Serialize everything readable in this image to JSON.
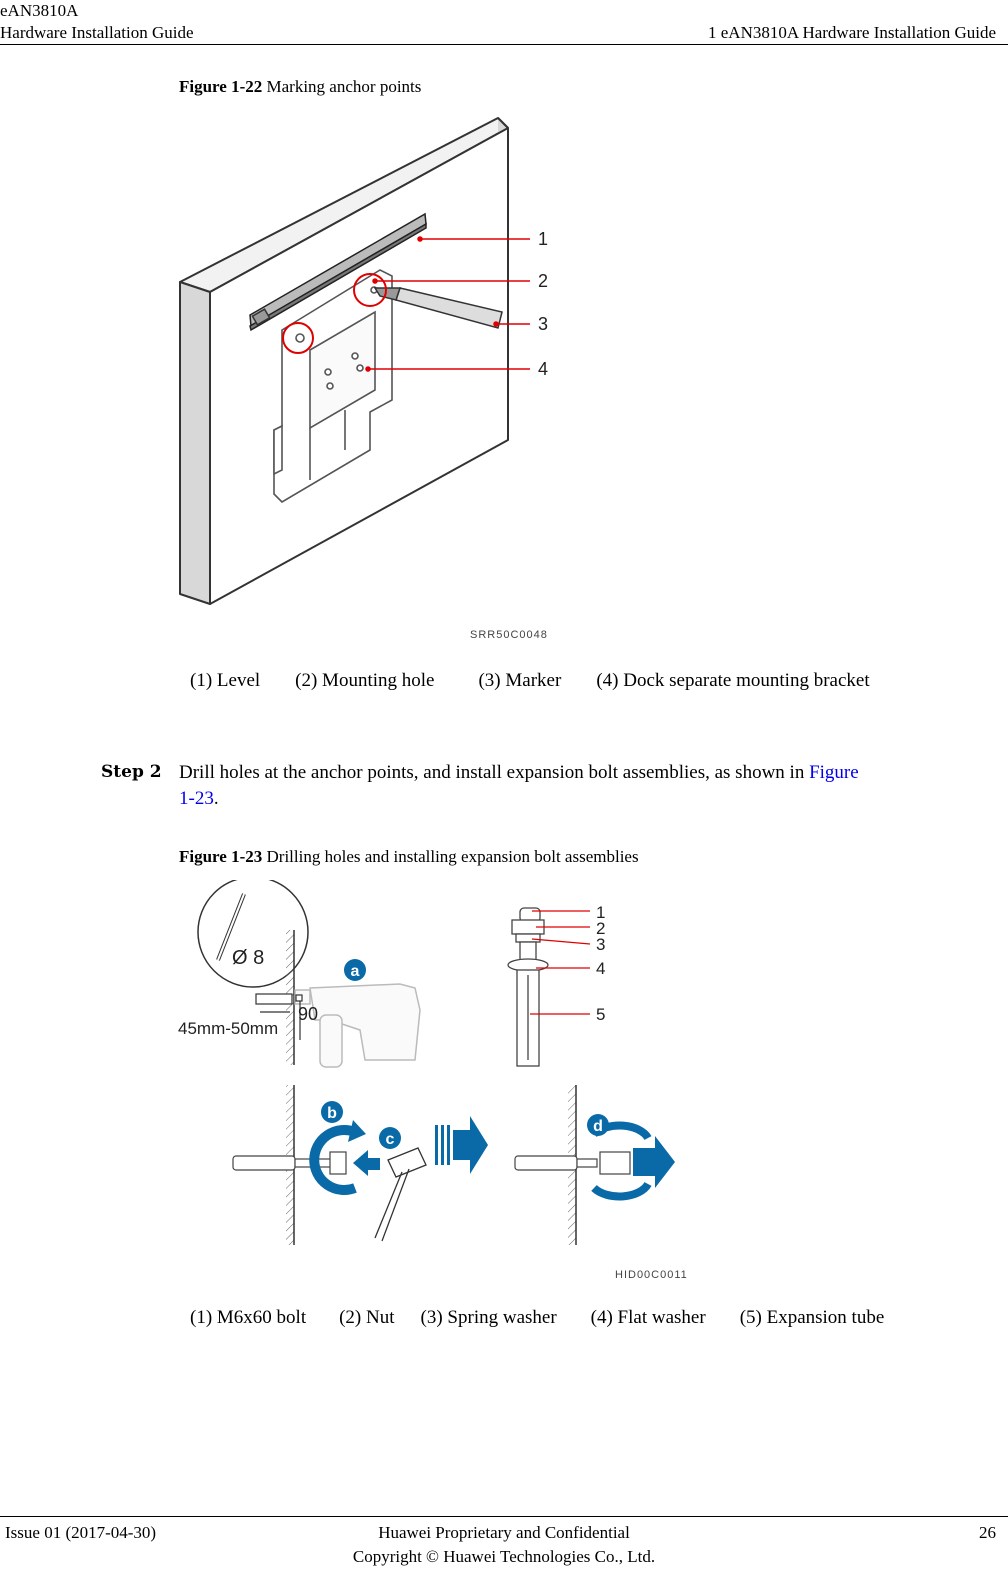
{
  "header": {
    "product": "eAN3810A",
    "doc_title": "Hardware Installation Guide",
    "chapter": "1 eAN3810A Hardware Installation Guide"
  },
  "figure22": {
    "number": "Figure 1-22",
    "title": " Marking anchor points",
    "code": "SRR50C0048",
    "callouts": [
      "1",
      "2",
      "3",
      "4"
    ],
    "legend": [
      "(1) Level",
      "(2) Mounting hole",
      "(3) Marker",
      "(4) Dock separate mounting bracket"
    ]
  },
  "step2": {
    "label": "Step 2",
    "text_before": "Drill holes at the anchor points, and install expansion bolt assemblies, as shown in ",
    "link_line1": "Figure",
    "link_line2": "1-23",
    "text_after": "."
  },
  "figure23": {
    "number": "Figure 1-23",
    "title": " Drilling holes and installing expansion bolt assemblies",
    "code": "HID00C0011",
    "drill_bit": "Ø 8",
    "depth": "45mm-50mm",
    "angle": "90",
    "steps": [
      "a",
      "b",
      "c",
      "d"
    ],
    "callouts": [
      "1",
      "2",
      "3",
      "4",
      "5"
    ],
    "accent_color": "#0a6aa8",
    "legend": [
      "(1) M6x60 bolt",
      "(2) Nut",
      "(3) Spring washer",
      "(4) Flat washer",
      "(5) Expansion tube"
    ]
  },
  "footer": {
    "issue": "Issue 01 (2017-04-30)",
    "confidential": "Huawei Proprietary and Confidential",
    "copyright": "Copyright © Huawei Technologies Co., Ltd.",
    "page": "26"
  }
}
